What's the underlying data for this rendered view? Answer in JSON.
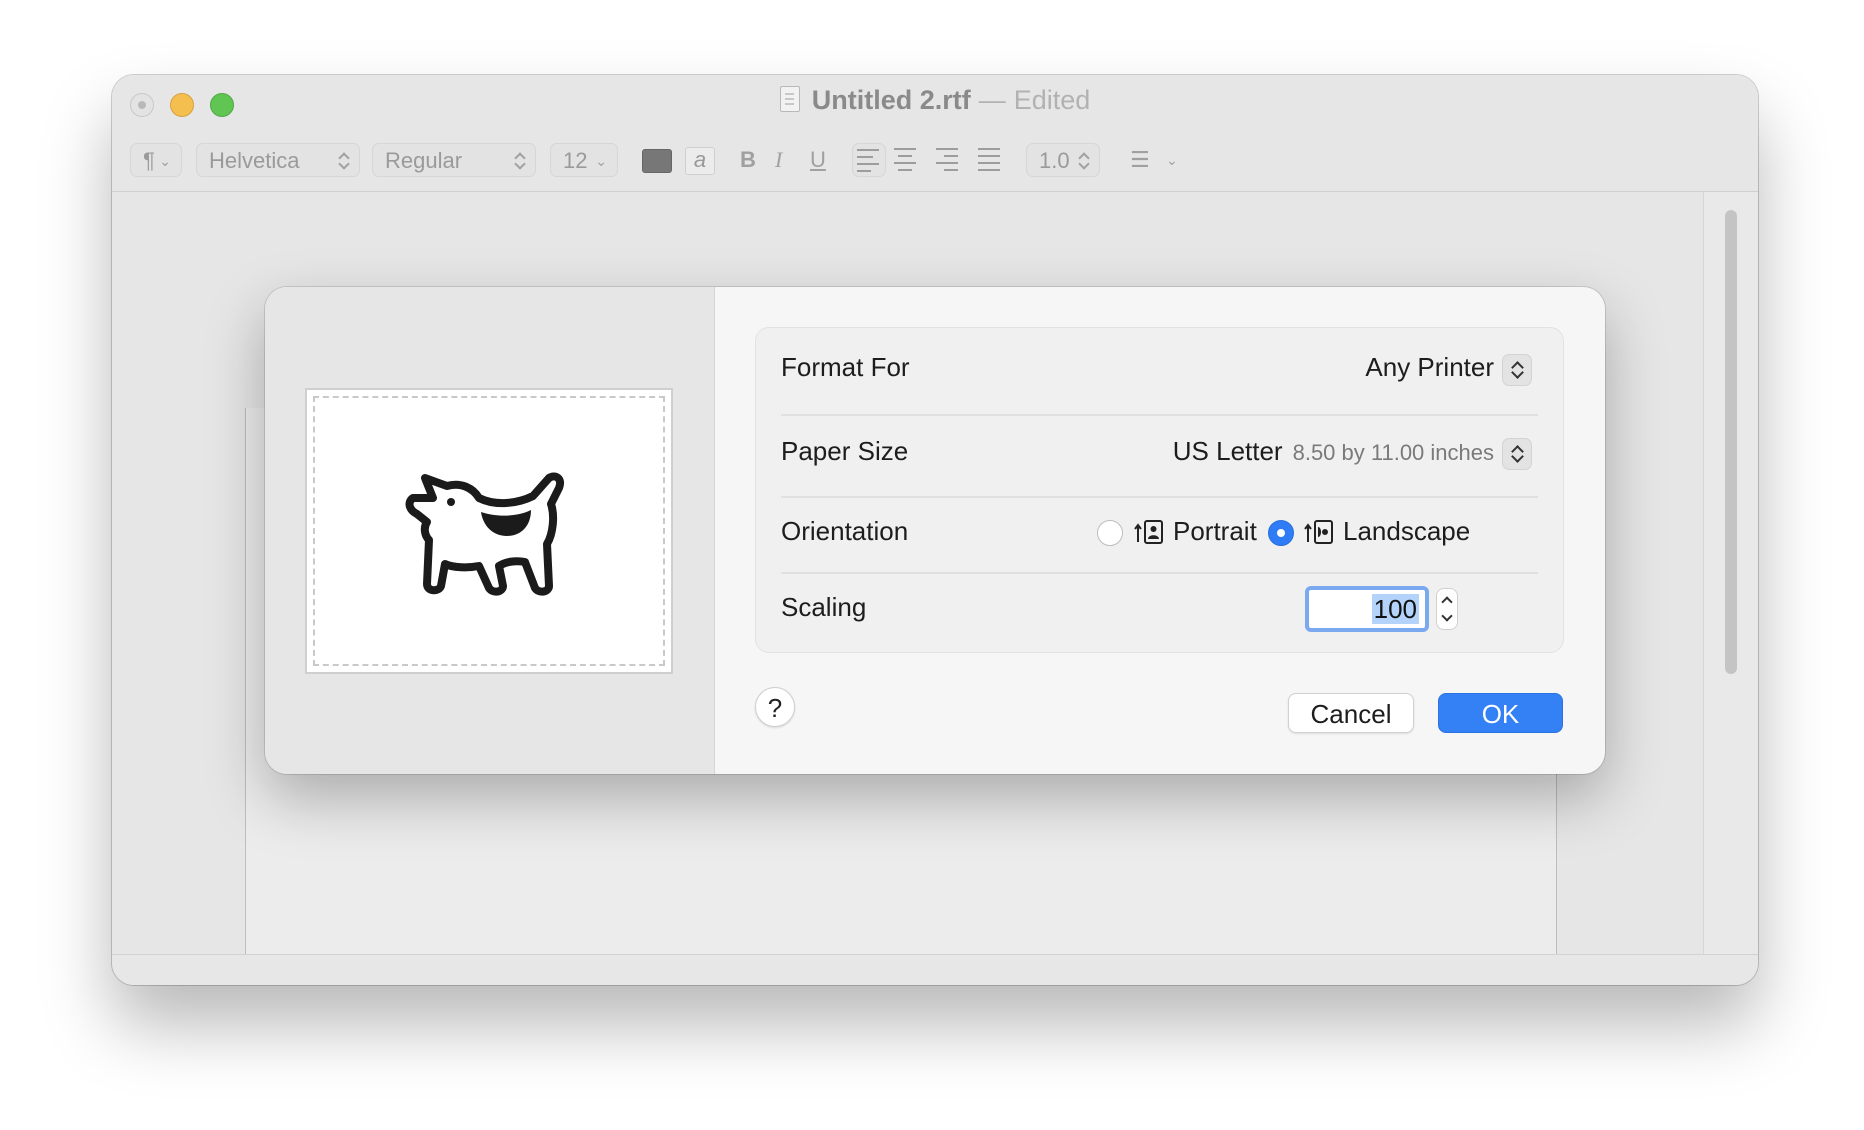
{
  "window": {
    "title": "Untitled 2.rtf",
    "separator": "—",
    "status": "Edited"
  },
  "toolbar": {
    "paragraph_icon": "¶",
    "font_family": "Helvetica",
    "font_style": "Regular",
    "font_size": "12",
    "text_color": "#777777",
    "bold": "B",
    "italic": "I",
    "underline": "U",
    "line_spacing": "1.0",
    "list_icon": "list-bullets-icon"
  },
  "dialog": {
    "format_for": {
      "label": "Format For",
      "value": "Any Printer"
    },
    "paper_size": {
      "label": "Paper Size",
      "value": "US Letter",
      "detail": "8.50 by 11.00 inches"
    },
    "orientation": {
      "label": "Orientation",
      "options": [
        "Portrait",
        "Landscape"
      ],
      "selected": "Landscape"
    },
    "scaling": {
      "label": "Scaling",
      "value": "100"
    },
    "help": "?",
    "cancel": "Cancel",
    "ok": "OK",
    "preview_icon": "dogcow-icon"
  },
  "colors": {
    "accent": "#3381f5",
    "close": "#e3e3e3",
    "minimize": "#f4bf4f",
    "maximize": "#61c554"
  }
}
